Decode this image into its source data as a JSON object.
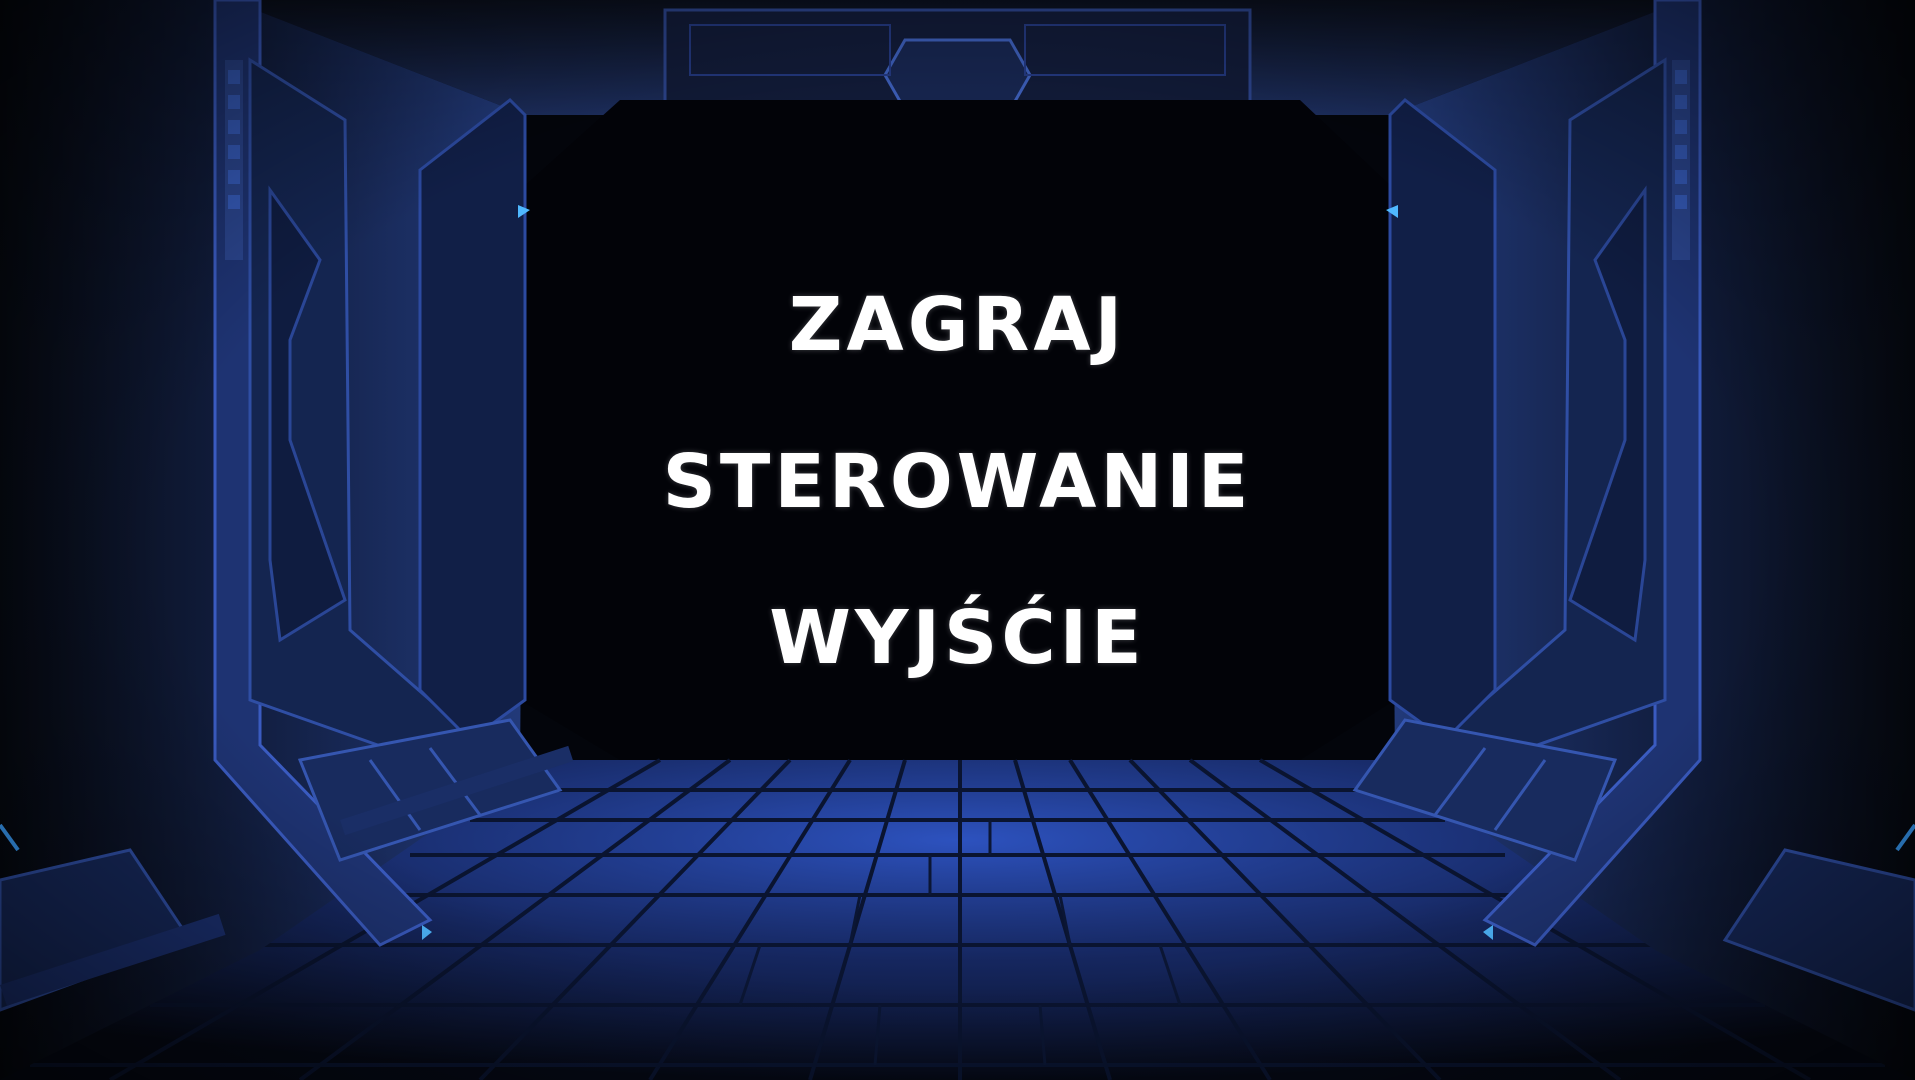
{
  "menu": {
    "items": [
      {
        "id": "play",
        "label": "ZAGRAJ"
      },
      {
        "id": "controls",
        "label": "STEROWANIE"
      },
      {
        "id": "exit",
        "label": "WYJŚĆIE"
      }
    ]
  },
  "colors": {
    "text": "#ffffff",
    "background": "#02040a",
    "wall": "#1b2a55",
    "accent": "#3b6bff",
    "light": "#4fb8ff"
  }
}
